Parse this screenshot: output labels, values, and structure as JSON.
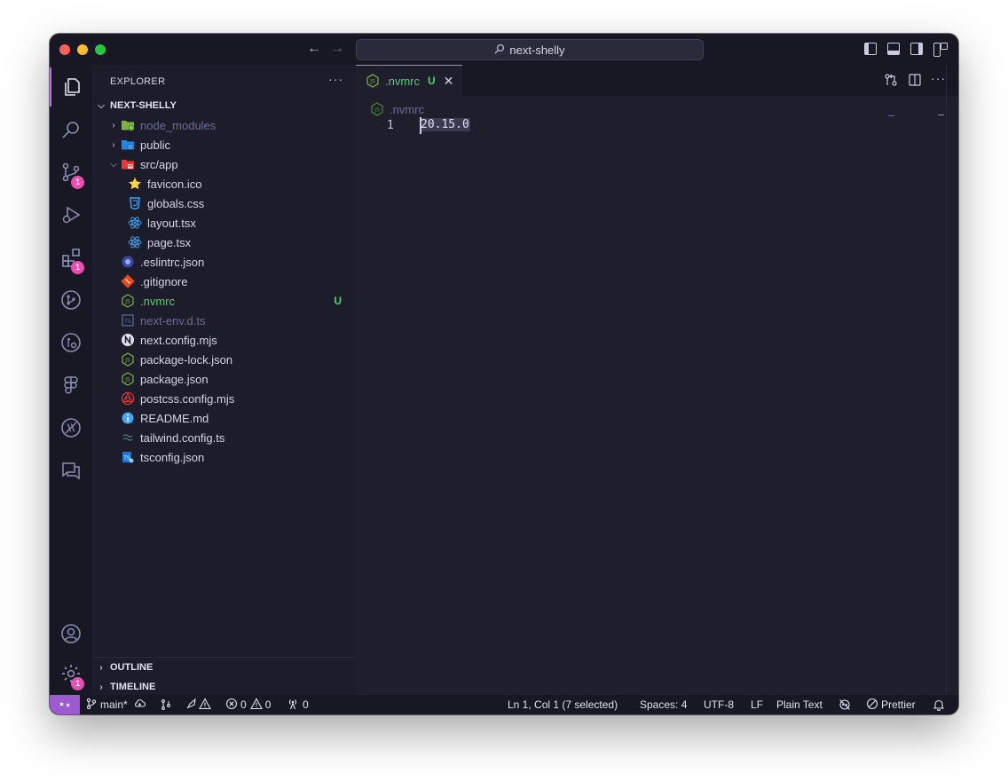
{
  "window": {
    "title": "next-shelly"
  },
  "explorer": {
    "title": "EXPLORER",
    "more": "···",
    "project": "NEXT-SHELLY",
    "items": [
      {
        "label": "node_modules",
        "kind": "folder"
      },
      {
        "label": "public",
        "kind": "folder"
      },
      {
        "label": "src/app",
        "kind": "folder"
      },
      {
        "label": "favicon.ico"
      },
      {
        "label": "globals.css"
      },
      {
        "label": "layout.tsx"
      },
      {
        "label": "page.tsx"
      },
      {
        "label": ".eslintrc.json"
      },
      {
        "label": ".gitignore"
      },
      {
        "label": ".nvmrc",
        "status": "U"
      },
      {
        "label": "next-env.d.ts"
      },
      {
        "label": "next.config.mjs"
      },
      {
        "label": "package-lock.json"
      },
      {
        "label": "package.json"
      },
      {
        "label": "postcss.config.mjs"
      },
      {
        "label": "README.md"
      },
      {
        "label": "tailwind.config.ts"
      },
      {
        "label": "tsconfig.json"
      }
    ],
    "outline": "OUTLINE",
    "timeline": "TIMELINE"
  },
  "activity": {
    "source_control_badge": "1",
    "extensions_badge": "1",
    "settings_badge": "1"
  },
  "editor": {
    "tab_label": ".nvmrc",
    "tab_status": "U",
    "breadcrumb": ".nvmrc",
    "line_number": "1",
    "code": "20.15.0"
  },
  "status": {
    "branch": "main*",
    "errors": "0",
    "warnings": "0",
    "ports": "0",
    "position": "Ln 1, Col 1 (7 selected)",
    "spaces": "Spaces: 4",
    "encoding": "UTF-8",
    "eol": "LF",
    "language": "Plain Text",
    "formatter": "Prettier"
  }
}
